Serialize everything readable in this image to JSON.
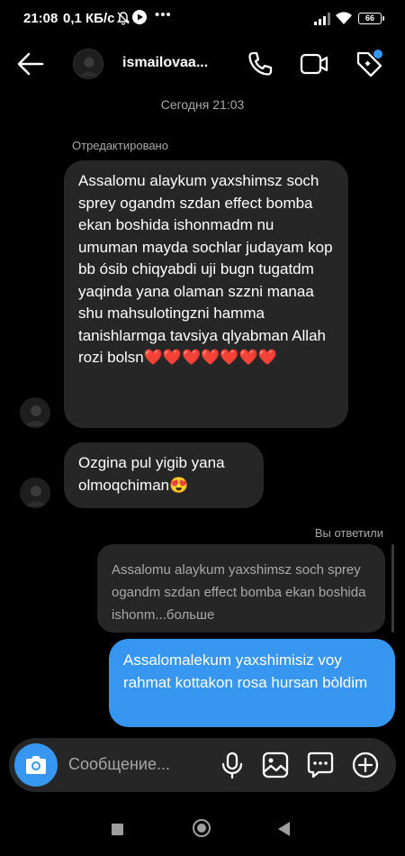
{
  "status_bar": {
    "time": "21:08",
    "network_speed": "0,1 КБ/с",
    "dots": "•••",
    "battery": "66"
  },
  "header": {
    "username": "ismailovaa...",
    "icons": [
      "back-arrow-icon",
      "phone-icon",
      "video-camera-icon",
      "tag-icon"
    ]
  },
  "thread": {
    "date_separator": "Сегодня 21:03",
    "edited_label": "Отредактировано",
    "messages": [
      {
        "text": "Assalomu alaykum yaxshimsz soch sprey ogandm szdan effect bomba ekan boshida ishonmadm nu umuman mayda sochlar judayam kop bb ósib chiqyabdi uji bugn tugatdm yaqinda yana olaman szzni manaa shu mahsulotingzni hamma tanishlarmga tavsiya qlyabman Allah rozi bolsn",
        "hearts": "❤️❤️❤️❤️❤️❤️❤️"
      },
      {
        "text": "Ozgina pul yigib yana olmoqchiman",
        "emoji": "😍"
      }
    ],
    "replied_label": "Вы ответили",
    "quoted_text": "Assalomu alaykum yaxshimsz soch sprey ogandm szdan effect bomba ekan boshida ishonm...больше",
    "my_reply": "Assalomalekum yaxshimisiz voy rahmat kottakon rosa hursan bòldim"
  },
  "composer": {
    "placeholder": "Сообщение...",
    "icons": [
      "camera-icon",
      "microphone-icon",
      "gallery-icon",
      "sticker-icon",
      "plus-icon"
    ]
  },
  "colors": {
    "background": "#000000",
    "bubble_incoming": "#262626",
    "bubble_outgoing": "#3797f0",
    "secondary_text": "#a8a8a8",
    "heart": "#e0212d"
  }
}
